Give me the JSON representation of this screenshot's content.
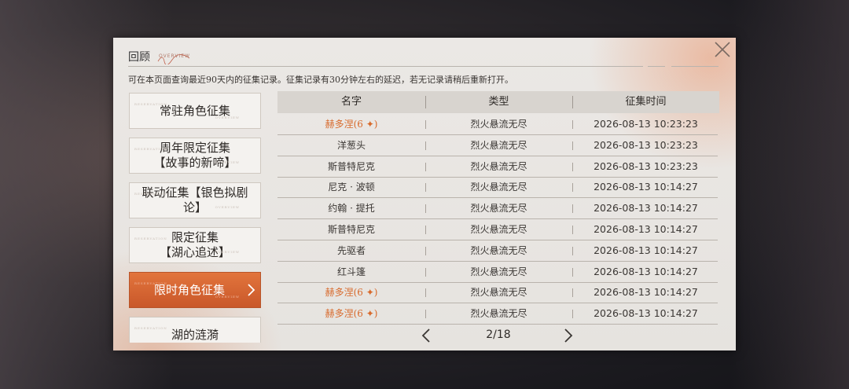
{
  "dialog": {
    "title": "回顾",
    "subtitle": "OVERVIEW",
    "notice": "可在本页面查询最近90天内的征集记录。征集记录有30分钟左右的延迟，若无记录请稍后重新打开。"
  },
  "sidebar": {
    "items": [
      {
        "line1": "常驻角色征集",
        "line2": "",
        "deco": "RESERVATION",
        "deco2": "OVERVIEW"
      },
      {
        "line1": "周年限定征集",
        "line2": "【故事的新啼】",
        "deco": "RESERVATION",
        "deco2": "OVERVIEW"
      },
      {
        "line1": "联动征集【银色拟剧",
        "line2": "论】",
        "deco": "RESERVATION",
        "deco2": "OVERVIEW"
      },
      {
        "line1": "限定征集",
        "line2": "【湖心追述】",
        "deco": "RESERVATION",
        "deco2": "OVERVIEW"
      },
      {
        "line1": "限时角色征集",
        "line2": "",
        "deco": "RESERVATION",
        "deco2": "OVERVIEW"
      },
      {
        "line1": "湖的涟漪",
        "line2": "",
        "deco": "RESERVATION",
        "deco2": ""
      }
    ]
  },
  "table": {
    "headers": [
      "名字",
      "类型",
      "征集时间"
    ],
    "rows": [
      {
        "name": "赫多涅(6 ✦)",
        "type": "烈火悬流无尽",
        "time": "2026-08-13 10:23:23"
      },
      {
        "name": "洋葱头",
        "type": "烈火悬流无尽",
        "time": "2026-08-13 10:23:23"
      },
      {
        "name": "斯普特尼克",
        "type": "烈火悬流无尽",
        "time": "2026-08-13 10:23:23"
      },
      {
        "name": "尼克 · 波顿",
        "type": "烈火悬流无尽",
        "time": "2026-08-13 10:14:27"
      },
      {
        "name": "约翰 · 提托",
        "type": "烈火悬流无尽",
        "time": "2026-08-13 10:14:27"
      },
      {
        "name": "斯普特尼克",
        "type": "烈火悬流无尽",
        "time": "2026-08-13 10:14:27"
      },
      {
        "name": "先驱者",
        "type": "烈火悬流无尽",
        "time": "2026-08-13 10:14:27"
      },
      {
        "name": "红斗篷",
        "type": "烈火悬流无尽",
        "time": "2026-08-13 10:14:27"
      },
      {
        "name": "赫多涅(6 ✦)",
        "type": "烈火悬流无尽",
        "time": "2026-08-13 10:14:27"
      },
      {
        "name": "赫多涅(6 ✦)",
        "type": "烈火悬流无尽",
        "time": "2026-08-13 10:14:27"
      }
    ]
  },
  "pager": {
    "text": "2/18"
  },
  "colors": {
    "accent": "#d86a2c",
    "active_tab": "#d2612f"
  }
}
